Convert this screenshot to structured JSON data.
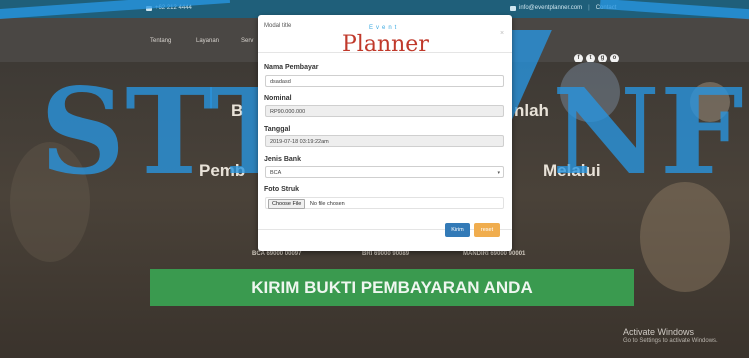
{
  "topbar": {
    "phone": "+62 212 4444",
    "email": "info@eventplanner.com",
    "separator": "|",
    "contact": "Contact"
  },
  "nav": {
    "items": [
      "Tentang",
      "Layanan",
      "Serv"
    ]
  },
  "social": {
    "icons": [
      "facebook-icon",
      "twitter-icon",
      "google-plus-icon",
      "instagram-icon"
    ],
    "glyphs": [
      "f",
      "t",
      "g",
      "o"
    ]
  },
  "hero": {
    "line1_left": "B",
    "line1_right": "nlah",
    "line2_left": "Pemb",
    "line2_right": "Melalui",
    "banks": [
      "BCA 69000 00097",
      "BRI 69000 90089",
      "MANDIRI 69000 90001"
    ],
    "cta": "KIRIM BUKTI PEMBAYARAN ANDA"
  },
  "activate": {
    "title": "Activate Windows",
    "subtitle": "Go to Settings to activate Windows."
  },
  "watermark": {
    "text_left": "STT",
    "text_right": "NF"
  },
  "modal": {
    "title": "Modal title",
    "logo_small": "Event",
    "logo_big": "Planner",
    "close": "×",
    "fields": {
      "nama": {
        "label": "Nama Pembayar",
        "value": "dsadasd"
      },
      "nominal": {
        "label": "Nominal",
        "value": "RP90.000.000"
      },
      "tanggal": {
        "label": "Tanggal",
        "value": "2019-07-18 03:19:22am"
      },
      "bank": {
        "label": "Jenis Bank",
        "value": "BCA"
      },
      "foto": {
        "label": "Foto Struk",
        "button": "Choose File",
        "status": "No file chosen"
      }
    },
    "buttons": {
      "submit": "Kirim",
      "reset": "reset"
    }
  },
  "colors": {
    "accent": "#1f5f7a",
    "cta": "#3a9a4f",
    "primary_btn": "#337ab7",
    "warning_btn": "#f0ad4e",
    "logo": "#c0392b",
    "watermark": "#2896e1"
  }
}
